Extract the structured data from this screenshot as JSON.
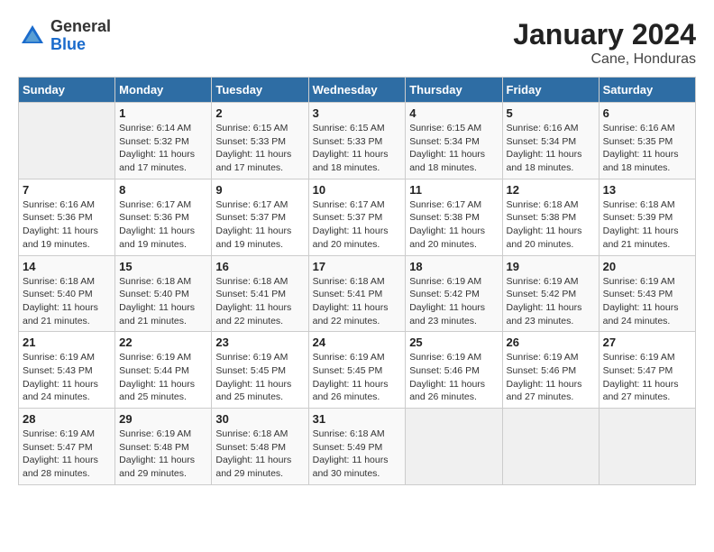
{
  "header": {
    "logo_general": "General",
    "logo_blue": "Blue",
    "title": "January 2024",
    "subtitle": "Cane, Honduras"
  },
  "columns": [
    "Sunday",
    "Monday",
    "Tuesday",
    "Wednesday",
    "Thursday",
    "Friday",
    "Saturday"
  ],
  "weeks": [
    [
      {
        "day": "",
        "info": ""
      },
      {
        "day": "1",
        "info": "Sunrise: 6:14 AM\nSunset: 5:32 PM\nDaylight: 11 hours\nand 17 minutes."
      },
      {
        "day": "2",
        "info": "Sunrise: 6:15 AM\nSunset: 5:33 PM\nDaylight: 11 hours\nand 17 minutes."
      },
      {
        "day": "3",
        "info": "Sunrise: 6:15 AM\nSunset: 5:33 PM\nDaylight: 11 hours\nand 18 minutes."
      },
      {
        "day": "4",
        "info": "Sunrise: 6:15 AM\nSunset: 5:34 PM\nDaylight: 11 hours\nand 18 minutes."
      },
      {
        "day": "5",
        "info": "Sunrise: 6:16 AM\nSunset: 5:34 PM\nDaylight: 11 hours\nand 18 minutes."
      },
      {
        "day": "6",
        "info": "Sunrise: 6:16 AM\nSunset: 5:35 PM\nDaylight: 11 hours\nand 18 minutes."
      }
    ],
    [
      {
        "day": "7",
        "info": "Sunrise: 6:16 AM\nSunset: 5:36 PM\nDaylight: 11 hours\nand 19 minutes."
      },
      {
        "day": "8",
        "info": "Sunrise: 6:17 AM\nSunset: 5:36 PM\nDaylight: 11 hours\nand 19 minutes."
      },
      {
        "day": "9",
        "info": "Sunrise: 6:17 AM\nSunset: 5:37 PM\nDaylight: 11 hours\nand 19 minutes."
      },
      {
        "day": "10",
        "info": "Sunrise: 6:17 AM\nSunset: 5:37 PM\nDaylight: 11 hours\nand 20 minutes."
      },
      {
        "day": "11",
        "info": "Sunrise: 6:17 AM\nSunset: 5:38 PM\nDaylight: 11 hours\nand 20 minutes."
      },
      {
        "day": "12",
        "info": "Sunrise: 6:18 AM\nSunset: 5:38 PM\nDaylight: 11 hours\nand 20 minutes."
      },
      {
        "day": "13",
        "info": "Sunrise: 6:18 AM\nSunset: 5:39 PM\nDaylight: 11 hours\nand 21 minutes."
      }
    ],
    [
      {
        "day": "14",
        "info": "Sunrise: 6:18 AM\nSunset: 5:40 PM\nDaylight: 11 hours\nand 21 minutes."
      },
      {
        "day": "15",
        "info": "Sunrise: 6:18 AM\nSunset: 5:40 PM\nDaylight: 11 hours\nand 21 minutes."
      },
      {
        "day": "16",
        "info": "Sunrise: 6:18 AM\nSunset: 5:41 PM\nDaylight: 11 hours\nand 22 minutes."
      },
      {
        "day": "17",
        "info": "Sunrise: 6:18 AM\nSunset: 5:41 PM\nDaylight: 11 hours\nand 22 minutes."
      },
      {
        "day": "18",
        "info": "Sunrise: 6:19 AM\nSunset: 5:42 PM\nDaylight: 11 hours\nand 23 minutes."
      },
      {
        "day": "19",
        "info": "Sunrise: 6:19 AM\nSunset: 5:42 PM\nDaylight: 11 hours\nand 23 minutes."
      },
      {
        "day": "20",
        "info": "Sunrise: 6:19 AM\nSunset: 5:43 PM\nDaylight: 11 hours\nand 24 minutes."
      }
    ],
    [
      {
        "day": "21",
        "info": "Sunrise: 6:19 AM\nSunset: 5:43 PM\nDaylight: 11 hours\nand 24 minutes."
      },
      {
        "day": "22",
        "info": "Sunrise: 6:19 AM\nSunset: 5:44 PM\nDaylight: 11 hours\nand 25 minutes."
      },
      {
        "day": "23",
        "info": "Sunrise: 6:19 AM\nSunset: 5:45 PM\nDaylight: 11 hours\nand 25 minutes."
      },
      {
        "day": "24",
        "info": "Sunrise: 6:19 AM\nSunset: 5:45 PM\nDaylight: 11 hours\nand 26 minutes."
      },
      {
        "day": "25",
        "info": "Sunrise: 6:19 AM\nSunset: 5:46 PM\nDaylight: 11 hours\nand 26 minutes."
      },
      {
        "day": "26",
        "info": "Sunrise: 6:19 AM\nSunset: 5:46 PM\nDaylight: 11 hours\nand 27 minutes."
      },
      {
        "day": "27",
        "info": "Sunrise: 6:19 AM\nSunset: 5:47 PM\nDaylight: 11 hours\nand 27 minutes."
      }
    ],
    [
      {
        "day": "28",
        "info": "Sunrise: 6:19 AM\nSunset: 5:47 PM\nDaylight: 11 hours\nand 28 minutes."
      },
      {
        "day": "29",
        "info": "Sunrise: 6:19 AM\nSunset: 5:48 PM\nDaylight: 11 hours\nand 29 minutes."
      },
      {
        "day": "30",
        "info": "Sunrise: 6:18 AM\nSunset: 5:48 PM\nDaylight: 11 hours\nand 29 minutes."
      },
      {
        "day": "31",
        "info": "Sunrise: 6:18 AM\nSunset: 5:49 PM\nDaylight: 11 hours\nand 30 minutes."
      },
      {
        "day": "",
        "info": ""
      },
      {
        "day": "",
        "info": ""
      },
      {
        "day": "",
        "info": ""
      }
    ]
  ]
}
